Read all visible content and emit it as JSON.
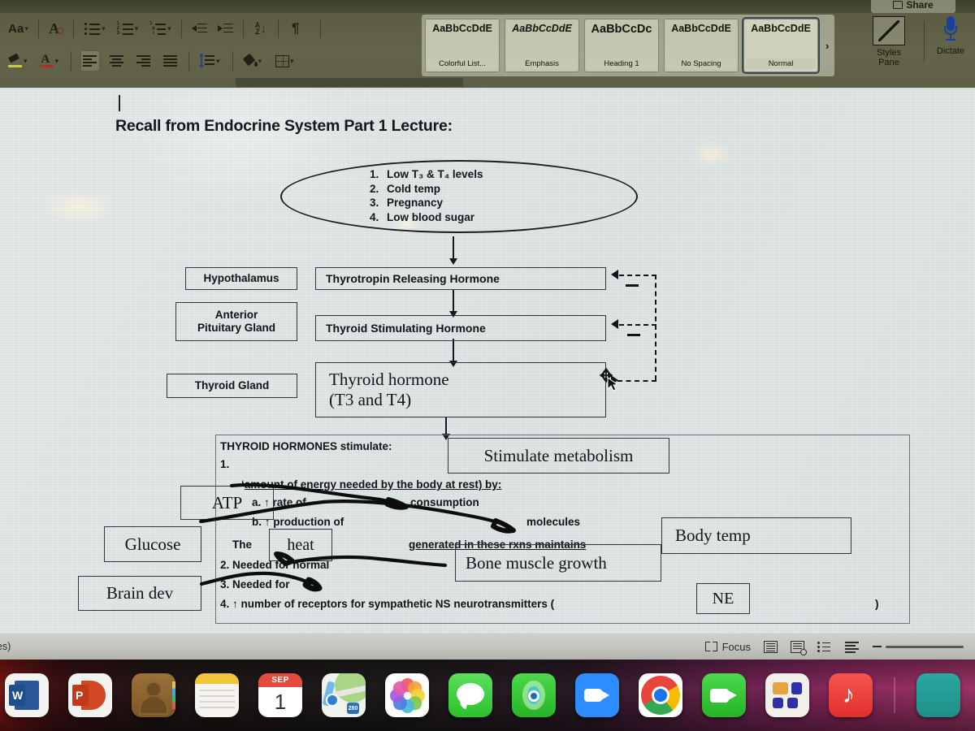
{
  "window": {
    "share_button": "Share"
  },
  "ribbon": {
    "paragraph_group": {
      "change_case_label": "Aa",
      "clear_formatting_label": "A",
      "bullets_label": "bullets-list",
      "numbering_label": "numbered-list",
      "multilevel_label": "multilevel-list",
      "decrease_indent_label": "decrease-indent",
      "increase_indent_label": "increase-indent",
      "sort_label_top": "A",
      "sort_label_bottom": "Z",
      "show_marks_label": "¶",
      "align_left_label": "align-left",
      "align_center_label": "align-center",
      "align_right_label": "align-right",
      "justify_label": "justify",
      "line_spacing_label": "line-spacing",
      "shading_label": "shading",
      "borders_label": "borders",
      "highlight_label": "text-highlight",
      "font_color_label": "A"
    },
    "styles_gallery": [
      {
        "preview": "AaBbCcDdE",
        "name": "Colorful List...",
        "active": false,
        "italic": false,
        "size": "12px"
      },
      {
        "preview": "AaBbCcDdE",
        "name": "Emphasis",
        "active": false,
        "italic": true,
        "size": "12px"
      },
      {
        "preview": "AaBbCcDc",
        "name": "Heading 1",
        "active": false,
        "italic": false,
        "size": "14px"
      },
      {
        "preview": "AaBbCcDdE",
        "name": "No Spacing",
        "active": false,
        "italic": false,
        "size": "12px"
      },
      {
        "preview": "AaBbCcDdE",
        "name": "Normal",
        "active": true,
        "italic": false,
        "size": "12px"
      }
    ],
    "gallery_more": "›",
    "styles_pane": "Styles\nPane",
    "styles_pane_line1": "Styles",
    "styles_pane_line2": "Pane",
    "dictate": "Dictate"
  },
  "document": {
    "title": "Recall from Endocrine System Part 1 Lecture:",
    "oval_list": [
      {
        "num": "1.",
        "text": "Low T₃ & T₄ levels"
      },
      {
        "num": "2.",
        "text": "Cold temp"
      },
      {
        "num": "3.",
        "text": "Pregnancy"
      },
      {
        "num": "4.",
        "text": "Low blood sugar"
      }
    ],
    "gland_labels": [
      "Hypothalamus",
      "Anterior\nPituitary Gland",
      "Thyroid Gland"
    ],
    "gland_hypothalamus": "Hypothalamus",
    "gland_pituitary_line1": "Anterior",
    "gland_pituitary_line2": "Pituitary Gland",
    "gland_thyroid": "Thyroid Gland",
    "hormone_trh": "Thyrotropin Releasing Hormone",
    "hormone_tsh": "Thyroid Stimulating Hormone",
    "hormone_t3t4_line1": "Thyroid hormone",
    "hormone_t3t4_line2": "(T3 and T4)",
    "feedback_sign": "—",
    "lower_block": {
      "heading": "THYROID HORMONES stimulate:",
      "item1_num": "1.",
      "item1_tail": "amount of energy needed by the body at rest)  by:",
      "item1_quote": "‘",
      "sub_a": "a. ↑ rate of",
      "sub_a_tail": "consumption",
      "sub_b": "b. ↑ production of",
      "sub_b_tail": "molecules",
      "the_word": "The",
      "generated_text": "generated in these rxns maintains",
      "item2": "2. Needed for normal",
      "item3": "3. Needed for",
      "item4": "4. ↑ number of receptors for sympathetic NS neurotransmitters (",
      "item4_close": ")"
    },
    "answer_boxes": {
      "stimulate_metabolism": "Stimulate metabolism",
      "atp": "ATP",
      "glucose": "Glucose",
      "heat": "heat",
      "body_temp": "Body temp",
      "bone_muscle": "Bone muscle growth",
      "brain_dev": "Brain dev",
      "ne": "NE"
    }
  },
  "status_bar": {
    "left_text": "tates)",
    "focus_label": "Focus",
    "print_layout_icon": "print-layout-view-icon",
    "web_layout_icon": "web-layout-view-icon",
    "outline_icon": "outline-view-icon",
    "draft_icon": "draft-view-icon",
    "zoom_out_label": "–"
  },
  "dock": {
    "apps": [
      {
        "name": "microsoft-word",
        "letter": "W"
      },
      {
        "name": "microsoft-powerpoint",
        "letter": "P"
      },
      {
        "name": "contacts",
        "letter": ""
      },
      {
        "name": "notes",
        "letter": ""
      },
      {
        "name": "calendar",
        "month": "SEP",
        "day": "1"
      },
      {
        "name": "maps",
        "badge": "280"
      },
      {
        "name": "photos",
        "letter": ""
      },
      {
        "name": "messages",
        "letter": ""
      },
      {
        "name": "find-my",
        "letter": ""
      },
      {
        "name": "zoom",
        "letter": ""
      },
      {
        "name": "google-chrome",
        "letter": ""
      },
      {
        "name": "facetime",
        "letter": ""
      },
      {
        "name": "launchpad",
        "letter": ""
      },
      {
        "name": "music",
        "letter": "♪"
      },
      {
        "name": "microsoft-edge",
        "letter": ""
      }
    ]
  },
  "colors": {
    "ribbon_bg": "#5c5d44",
    "page_bg": "#e2e7e6",
    "ink": "#0d0d0d",
    "box_border": "#30383c",
    "accent_blue": "#2b579a",
    "accent_red": "#d24726"
  }
}
